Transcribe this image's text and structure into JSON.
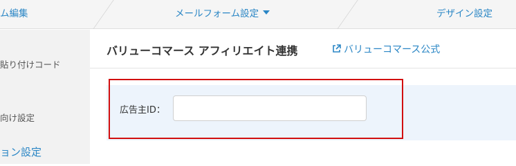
{
  "topnav": {
    "left_label": "ム編集",
    "mid_label": "メールフォーム設定",
    "right_label": "デザイン設定"
  },
  "sidebar": {
    "items": [
      {
        "label": "貼り付けコード"
      },
      {
        "label": "向け設定"
      },
      {
        "label": "ョン設定"
      }
    ]
  },
  "main": {
    "title": "バリューコマース アフィリエイト連携",
    "external_link": "バリューコマース公式",
    "form": {
      "advertiser_id_label": "広告主ID：",
      "advertiser_id_value": ""
    }
  },
  "colors": {
    "accent": "#2a86c5",
    "highlight_border": "#d20f0f",
    "panel_bg": "#edf4fc"
  }
}
